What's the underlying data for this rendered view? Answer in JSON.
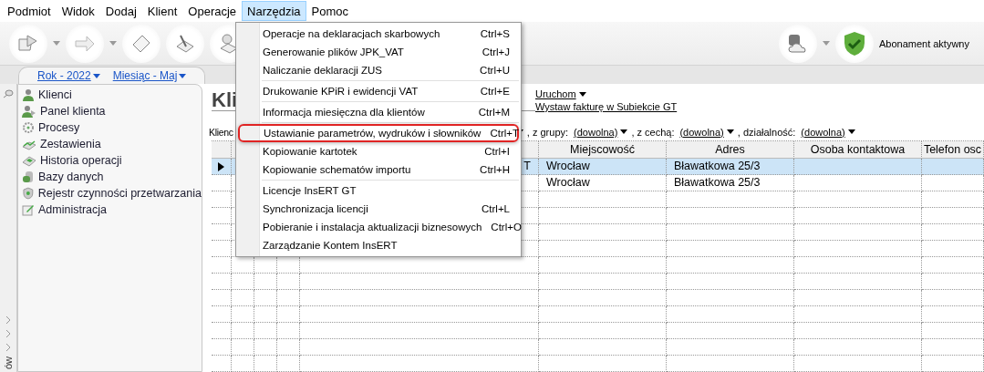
{
  "menubar": [
    {
      "label": "Podmiot",
      "selected": false
    },
    {
      "label": "Widok",
      "selected": false
    },
    {
      "label": "Dodaj",
      "selected": false
    },
    {
      "label": "Klient",
      "selected": false
    },
    {
      "label": "Operacje",
      "selected": false
    },
    {
      "label": "Narzędzia",
      "selected": true
    },
    {
      "label": "Pomoc",
      "selected": false
    }
  ],
  "toolbar": {
    "subscription": "Abonament aktywny"
  },
  "period": [
    "Rok - 2022",
    "Miesiąc - Maj"
  ],
  "sidebar": {
    "items": [
      "Klienci",
      "Panel klienta",
      "Procesy",
      "Zestawienia",
      "Historia operacji",
      "Bazy danych",
      "Rejestr czynności przetwarzania",
      "Administracja"
    ],
    "collapsed_label": "ów"
  },
  "content": {
    "title": "Kli",
    "actions": [
      {
        "label": "Uruchom",
        "dropdown": true
      },
      {
        "label": "Wystaw fakturę w Subiekcie GT",
        "dropdown": false
      }
    ],
    "filter": {
      "label": "Klienc",
      "groups": [
        {
          "label": ", z grupy:",
          "value": "(dowolna)"
        },
        {
          "label": ", z cechą:",
          "value": "(dowolna)"
        },
        {
          "label": ", działalność:",
          "value": "(dowolna)"
        }
      ]
    }
  },
  "table": {
    "columns": [
      "Miejscowość",
      "Adres",
      "Osoba kontaktowa",
      "Telefon osc"
    ],
    "rows": [
      {
        "selected": true,
        "column_5": "T",
        "city": "Wrocław",
        "address": "Bławatkowa 25/3"
      },
      {
        "selected": false,
        "city": "Wrocław",
        "address": "Bławatkowa 25/3"
      }
    ]
  },
  "menu": {
    "groups": [
      [
        {
          "label": "Operacje na deklaracjach skarbowych",
          "shortcut": "Ctrl+S",
          "marked": false
        },
        {
          "label": "Generowanie plików JPK_VAT",
          "shortcut": "Ctrl+J",
          "marked": false
        },
        {
          "label": "Naliczanie deklaracji ZUS",
          "shortcut": "Ctrl+U",
          "marked": false
        }
      ],
      [
        {
          "label": "Drukowanie KPiR i ewidencji VAT",
          "shortcut": "Ctrl+E",
          "marked": false
        }
      ],
      [
        {
          "label": "Informacja miesięczna dla klientów",
          "shortcut": "Ctrl+M",
          "marked": false
        }
      ],
      [
        {
          "label": "Ustawianie parametrów, wydruków i słowników",
          "shortcut": "Ctrl+T",
          "marked": true
        },
        {
          "label": "Kopiowanie kartotek",
          "shortcut": "Ctrl+I",
          "marked": false
        },
        {
          "label": "Kopiowanie schematów importu",
          "shortcut": "Ctrl+H",
          "marked": false
        }
      ],
      [
        {
          "label": "Licencje InsERT GT",
          "marked": false
        },
        {
          "label": "Synchronizacja licencji",
          "shortcut": "Ctrl+L",
          "marked": false
        },
        {
          "label": "Pobieranie i instalacja aktualizacji biznesowych",
          "shortcut": "Ctrl+O",
          "marked": false
        },
        {
          "label": "Zarządzanie Kontem InsERT",
          "marked": false
        }
      ]
    ]
  }
}
